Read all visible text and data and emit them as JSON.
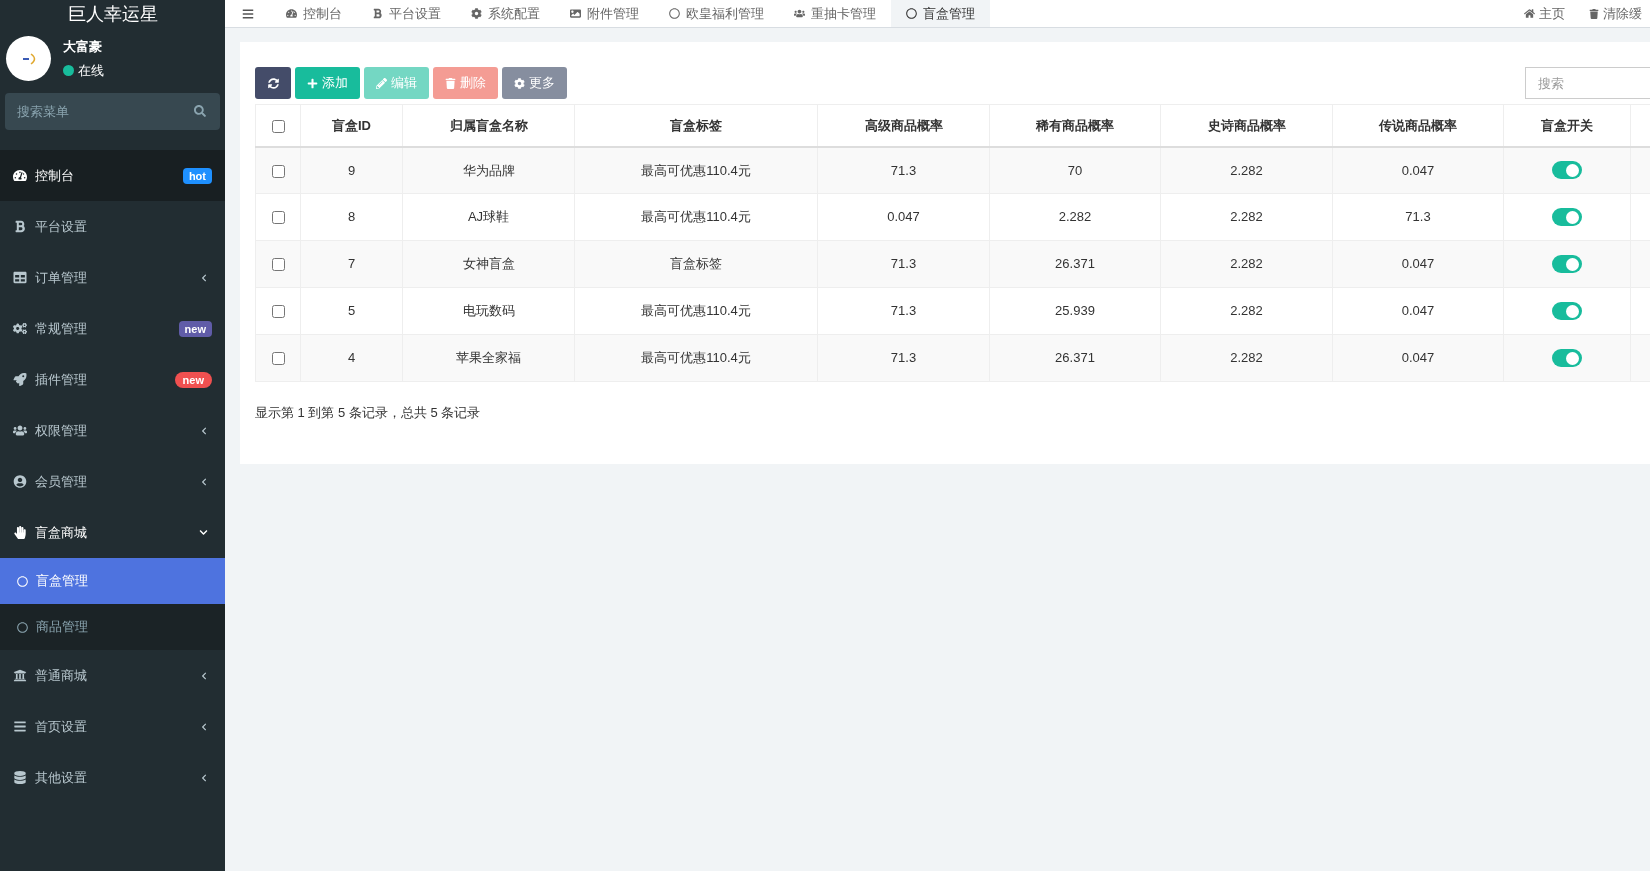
{
  "sidebar": {
    "logo": "巨人幸运星",
    "user": {
      "name": "大富豪",
      "status": "在线"
    },
    "search": {
      "placeholder": "搜索菜单"
    },
    "items": [
      {
        "label": "控制台",
        "selected": true,
        "badge": {
          "text": "hot",
          "color": "#1e90ff",
          "kind": "label"
        }
      },
      {
        "label": "平台设置",
        "selected": false
      },
      {
        "label": "订单管理",
        "selected": false,
        "expanded": false
      },
      {
        "label": "常规管理",
        "selected": false,
        "badge": {
          "text": "new",
          "color": "#605ca8",
          "kind": "label"
        }
      },
      {
        "label": "插件管理",
        "selected": false,
        "badge": {
          "text": "new",
          "color": "#f05050",
          "kind": "pill"
        }
      },
      {
        "label": "权限管理",
        "selected": false,
        "expanded": false
      },
      {
        "label": "会员管理",
        "selected": false,
        "expanded": false
      },
      {
        "label": "盲盒商城",
        "selected": false,
        "expanded": true,
        "children": [
          {
            "label": "盲盒管理",
            "selected": true
          },
          {
            "label": "商品管理",
            "selected": false
          }
        ]
      },
      {
        "label": "普通商城",
        "selected": false,
        "expanded": false
      },
      {
        "label": "首页设置",
        "selected": false,
        "expanded": false
      },
      {
        "label": "其他设置",
        "selected": false,
        "expanded": false
      }
    ]
  },
  "tabs": [
    {
      "label": "控制台",
      "selected": false
    },
    {
      "label": "平台设置",
      "selected": false
    },
    {
      "label": "系统配置",
      "selected": false
    },
    {
      "label": "附件管理",
      "selected": false
    },
    {
      "label": "欧皇福利管理",
      "selected": false
    },
    {
      "label": "重抽卡管理",
      "selected": false
    },
    {
      "label": "盲盒管理",
      "selected": true
    }
  ],
  "header_links": [
    "主页",
    "清除缓"
  ],
  "toolbar": {
    "buttons": [
      {
        "kind": "refresh"
      },
      {
        "kind": "add",
        "label": "添加"
      },
      {
        "kind": "edit",
        "label": "编辑"
      },
      {
        "kind": "delete",
        "label": "删除"
      },
      {
        "kind": "more",
        "label": "更多"
      }
    ],
    "search": {
      "placeholder": "搜索"
    }
  },
  "table": {
    "header_checked": false,
    "columns": [
      "盲盒ID",
      "归属盲盒名称",
      "盲盒标签",
      "高级商品概率",
      "稀有商品概率",
      "史诗商品概率",
      "传说商品概率",
      "盲盒开关"
    ],
    "rows": [
      {
        "checked": false,
        "cells": [
          "9",
          "华为品牌",
          "最高可优惠110.4元",
          "71.3",
          "70",
          "2.282",
          "0.047"
        ],
        "on": true
      },
      {
        "checked": false,
        "cells": [
          "8",
          "AJ球鞋",
          "最高可优惠110.4元",
          "0.047",
          "2.282",
          "2.282",
          "71.3"
        ],
        "on": true
      },
      {
        "checked": false,
        "cells": [
          "7",
          "女神盲盒",
          "盲盒标签",
          "71.3",
          "26.371",
          "2.282",
          "0.047"
        ],
        "on": true
      },
      {
        "checked": false,
        "cells": [
          "5",
          "电玩数码",
          "最高可优惠110.4元",
          "71.3",
          "25.939",
          "2.282",
          "0.047"
        ],
        "on": true
      },
      {
        "checked": false,
        "cells": [
          "4",
          "苹果全家福",
          "最高可优惠110.4元",
          "71.3",
          "26.371",
          "2.282",
          "0.047"
        ],
        "on": true
      }
    ]
  },
  "footer": "显示第 1 到第 5 条记录，总共 5 条记录"
}
